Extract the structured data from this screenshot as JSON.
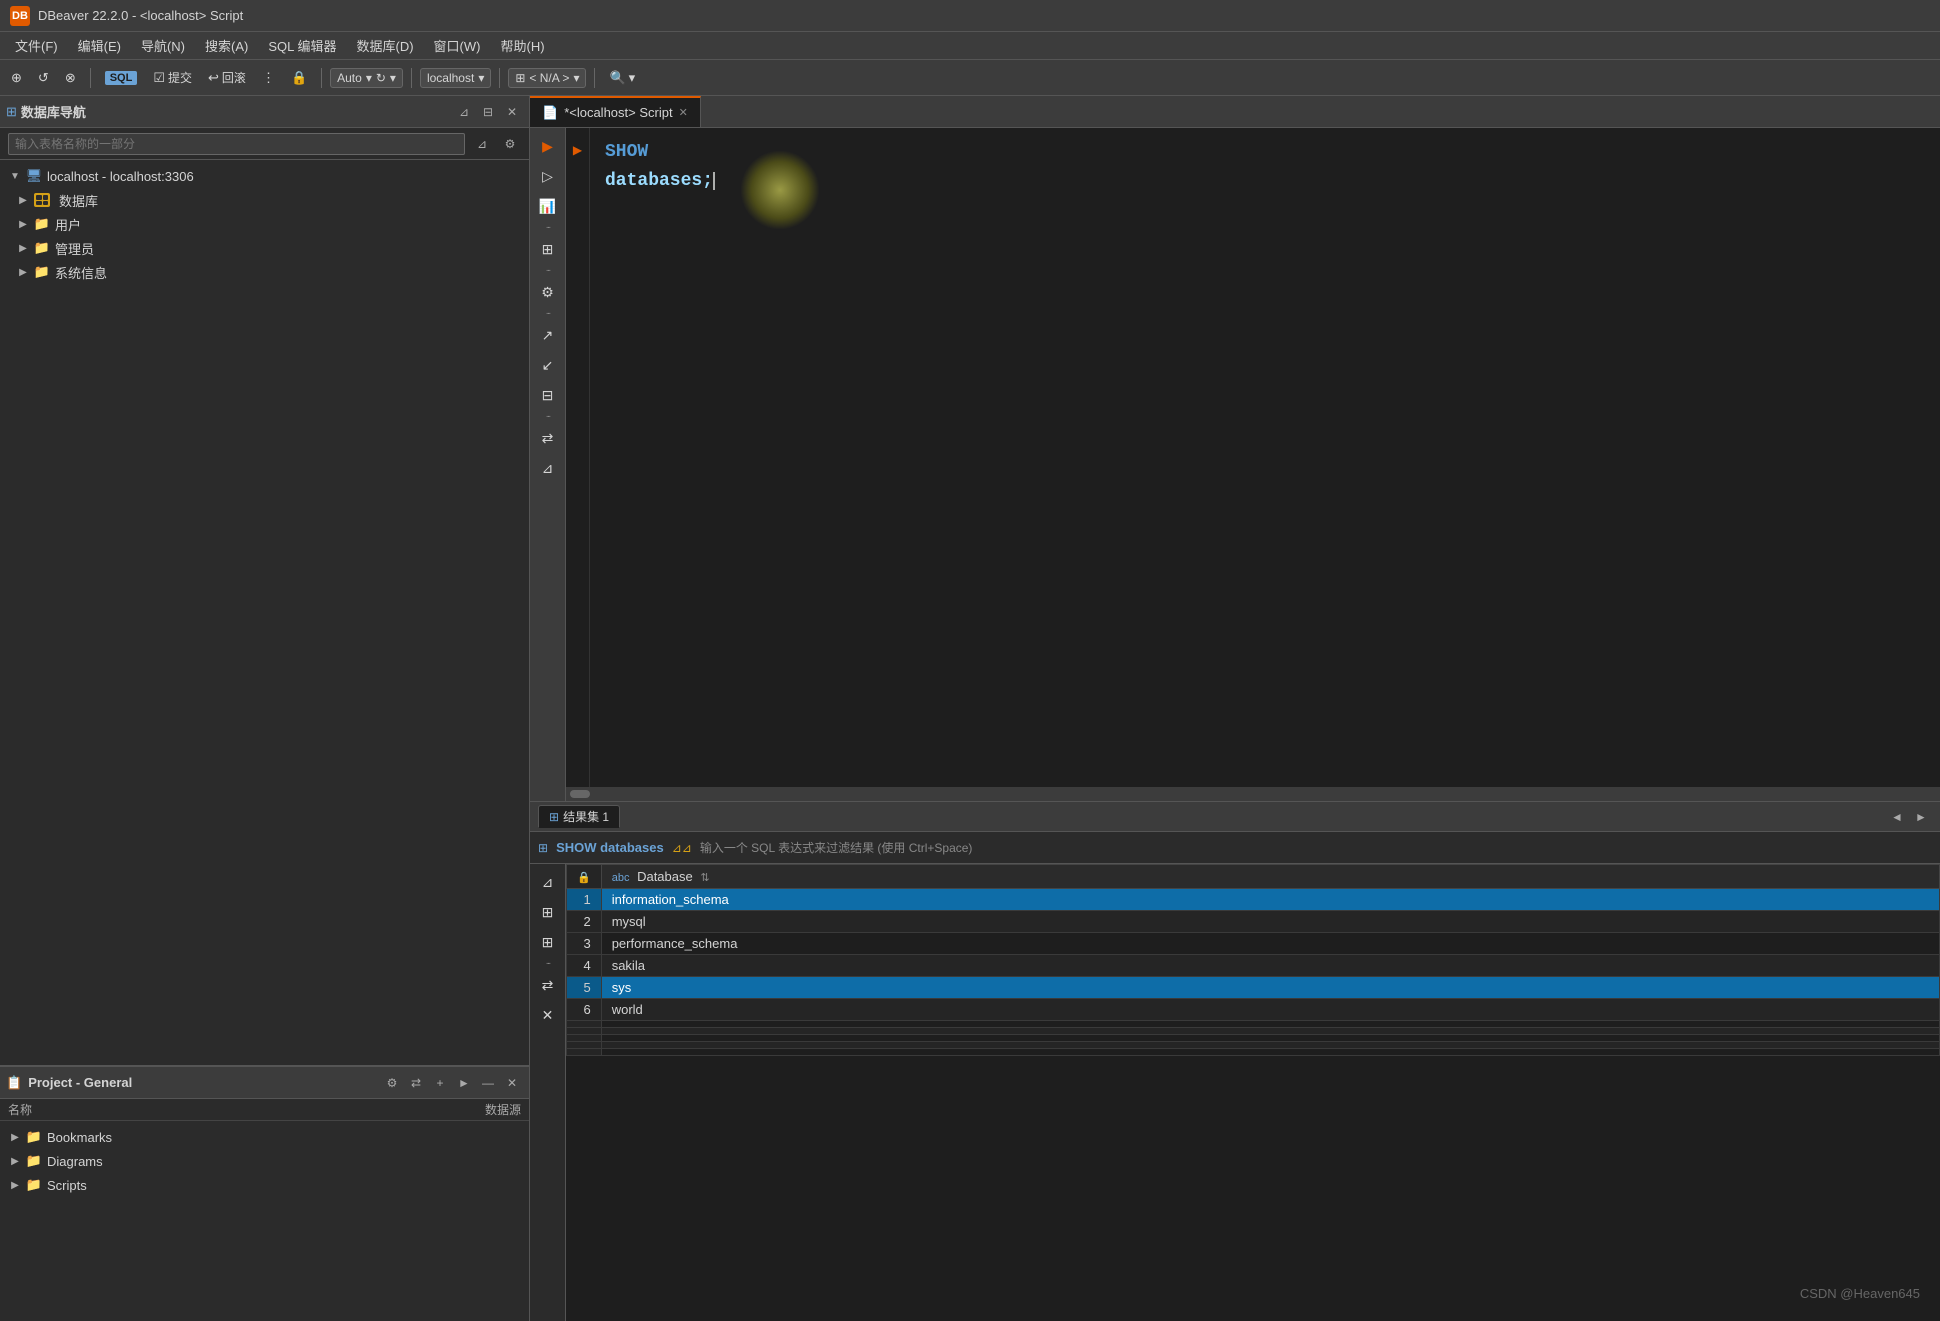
{
  "titlebar": {
    "icon_label": "DB",
    "title": "DBeaver 22.2.0 - <localhost> Script"
  },
  "menubar": {
    "items": [
      {
        "label": "文件(F)"
      },
      {
        "label": "编辑(E)"
      },
      {
        "label": "导航(N)"
      },
      {
        "label": "搜索(A)"
      },
      {
        "label": "SQL 编辑器"
      },
      {
        "label": "数据库(D)"
      },
      {
        "label": "窗口(W)"
      },
      {
        "label": "帮助(H)"
      }
    ]
  },
  "toolbar": {
    "connection_label": "localhost",
    "database_label": "< N/A >",
    "auto_label": "Auto"
  },
  "db_navigator": {
    "panel_title": "数据库导航",
    "search_placeholder": "输入表格名称的一部分",
    "tree": [
      {
        "label": "localhost - localhost:3306",
        "type": "server",
        "expanded": true,
        "children": [
          {
            "label": "数据库",
            "type": "folder",
            "expanded": false
          },
          {
            "label": "用户",
            "type": "folder",
            "expanded": false
          },
          {
            "label": "管理员",
            "type": "folder",
            "expanded": false
          },
          {
            "label": "系统信息",
            "type": "folder",
            "expanded": false
          }
        ]
      }
    ]
  },
  "editor": {
    "tab_label": "*<localhost> Script",
    "code_line1": "SHOW",
    "code_line2": "databases;",
    "cursor_after": "databases;"
  },
  "results": {
    "tab_label": "结果集 1",
    "show_label": "SHOW databases",
    "filter_hint": "输入一个 SQL 表达式来过滤结果 (使用 Ctrl+Space)",
    "columns": [
      {
        "label": "Database",
        "type": "abc"
      }
    ],
    "rows": [
      {
        "num": "1",
        "value": "information_schema",
        "selected": true
      },
      {
        "num": "2",
        "value": "mysql",
        "selected": false
      },
      {
        "num": "3",
        "value": "performance_schema",
        "selected": false
      },
      {
        "num": "4",
        "value": "sakila",
        "selected": false
      },
      {
        "num": "5",
        "value": "sys",
        "selected": true
      },
      {
        "num": "6",
        "value": "world",
        "selected": false
      }
    ]
  },
  "project": {
    "panel_title": "Project - General",
    "name_col": "名称",
    "data_col": "数据源",
    "items": [
      {
        "label": "Bookmarks",
        "type": "folder"
      },
      {
        "label": "Diagrams",
        "type": "folder"
      },
      {
        "label": "Scripts",
        "type": "folder"
      }
    ]
  },
  "watermark": {
    "text": "CSDN @Heaven645"
  },
  "icons": {
    "arrow_right": "▶",
    "arrow_down": "▼",
    "close": "✕",
    "folder": "📁",
    "database_grid": "⊞",
    "server": "🖥",
    "filter": "⊿",
    "lock": "🔒",
    "sort": "⇅",
    "abc": "abc",
    "settings": "⚙",
    "add": "+",
    "link": "⇄",
    "chevron_left": "◄",
    "chevron_right": "►"
  }
}
